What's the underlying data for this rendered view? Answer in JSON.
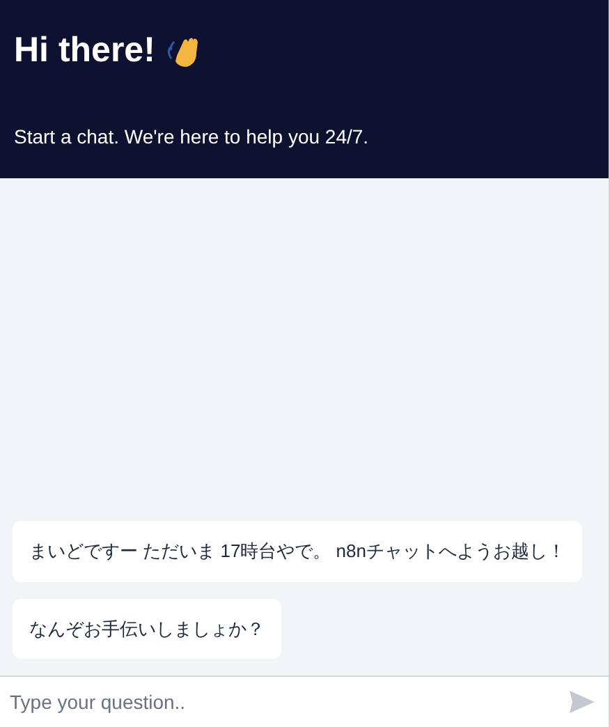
{
  "header": {
    "title": "Hi there!",
    "subtitle": "Start a chat. We're here to help you 24/7."
  },
  "messages": [
    {
      "text": "まいどですー ただいま 17時台やで。 n8nチャットへようお越し！"
    },
    {
      "text": "なんぞお手伝いしましょか？"
    }
  ],
  "input": {
    "placeholder": "Type your question.."
  }
}
